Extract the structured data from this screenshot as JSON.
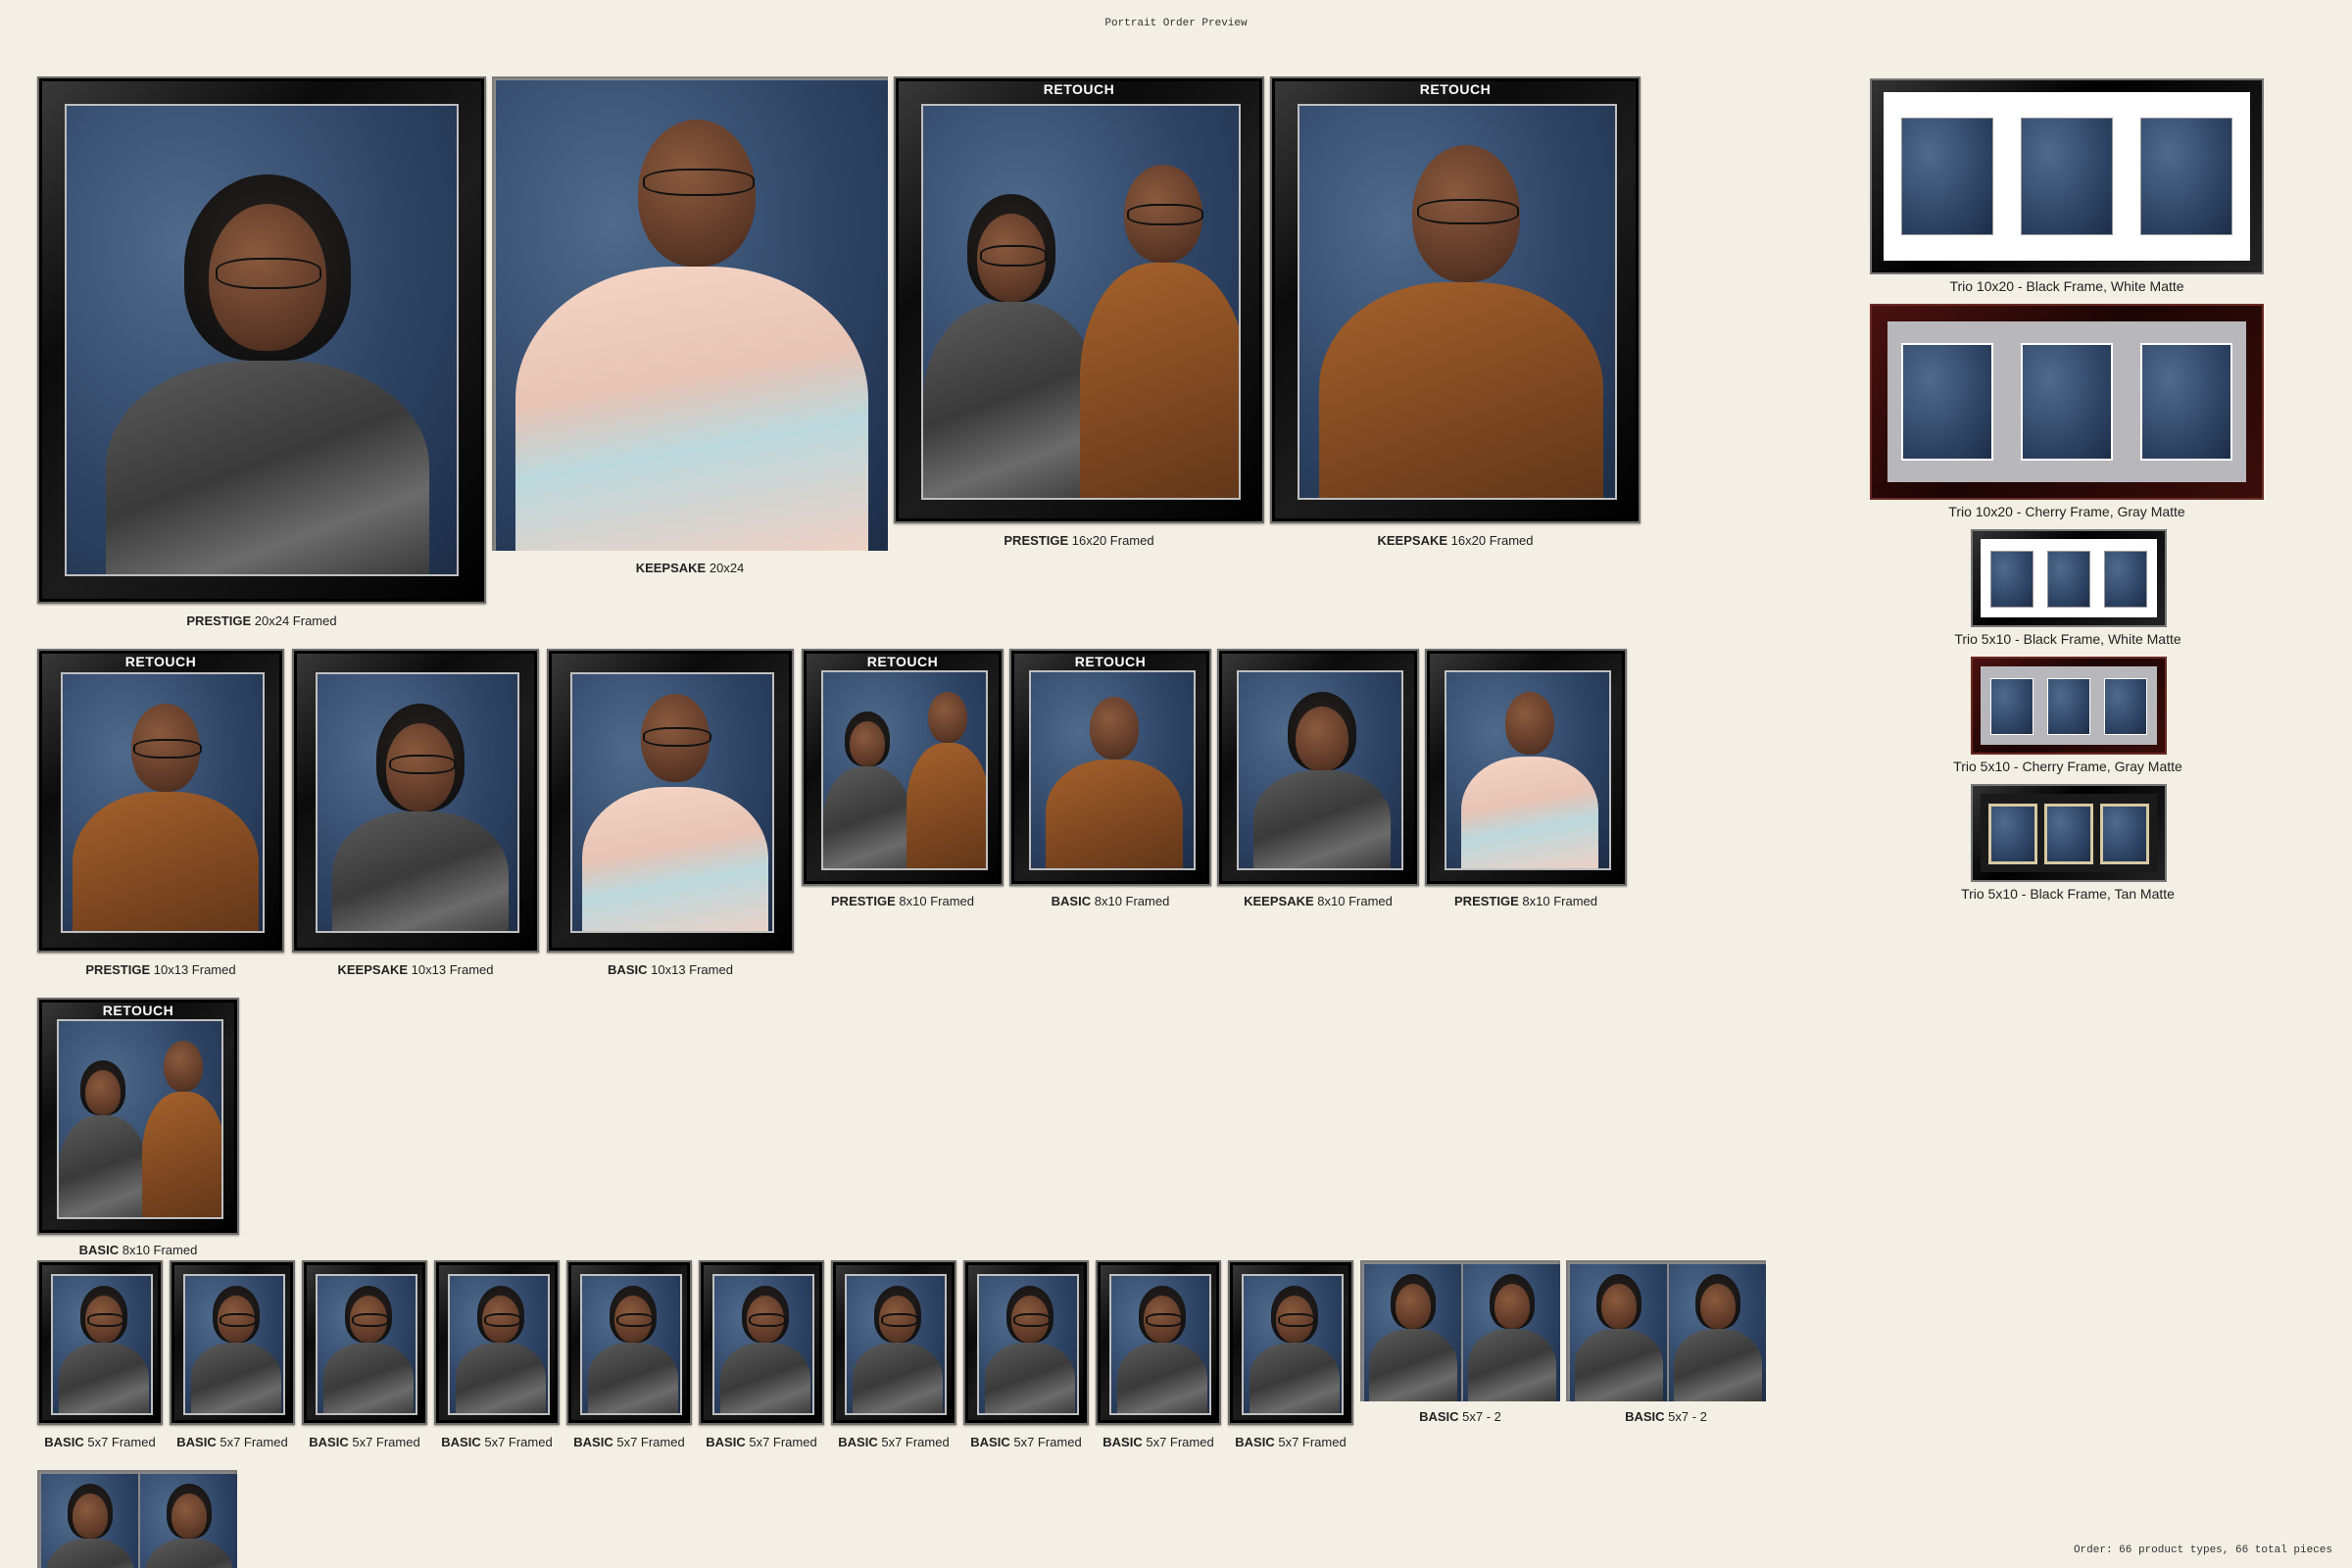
{
  "page": {
    "title": "Portrait Order Preview",
    "footer": "Order: 66 product types, 66 total pieces",
    "retouch_label": "RETOUCH"
  },
  "items": {
    "i1": {
      "tier": "PRESTIGE",
      "desc": "20x24 Framed"
    },
    "i2": {
      "tier": "KEEPSAKE",
      "desc": "20x24"
    },
    "i3": {
      "tier": "PRESTIGE",
      "desc": "16x20 Framed"
    },
    "i4": {
      "tier": "KEEPSAKE",
      "desc": "16x20 Framed"
    },
    "i5": {
      "tier": "PRESTIGE",
      "desc": "10x13 Framed"
    },
    "i6": {
      "tier": "KEEPSAKE",
      "desc": "10x13 Framed"
    },
    "i7": {
      "tier": "BASIC",
      "desc": "10x13 Framed"
    },
    "i8": {
      "tier": "PRESTIGE",
      "desc": "8x10 Framed"
    },
    "i9": {
      "tier": "BASIC",
      "desc": "8x10 Framed"
    },
    "i10": {
      "tier": "KEEPSAKE",
      "desc": "8x10 Framed"
    },
    "i11": {
      "tier": "PRESTIGE",
      "desc": "8x10 Framed"
    },
    "i12": {
      "tier": "BASIC",
      "desc": "8x10 Framed"
    },
    "s1": {
      "tier": "BASIC",
      "desc": "5x7 Framed"
    },
    "s2": {
      "tier": "BASIC",
      "desc": "5x7 Framed"
    },
    "s3": {
      "tier": "BASIC",
      "desc": "5x7 Framed"
    },
    "s4": {
      "tier": "BASIC",
      "desc": "5x7 Framed"
    },
    "s5": {
      "tier": "BASIC",
      "desc": "5x7 Framed"
    },
    "s6": {
      "tier": "BASIC",
      "desc": "5x7 Framed"
    },
    "s7": {
      "tier": "BASIC",
      "desc": "5x7 Framed"
    },
    "s8": {
      "tier": "BASIC",
      "desc": "5x7 Framed"
    },
    "s9": {
      "tier": "BASIC",
      "desc": "5x7 Framed"
    },
    "s10": {
      "tier": "BASIC",
      "desc": "5x7 Framed"
    },
    "p1": {
      "tier": "BASIC",
      "desc": "5x7 - 2"
    },
    "p2": {
      "tier": "BASIC",
      "desc": "5x7 - 2"
    }
  },
  "trios": {
    "t1": "Trio 10x20 - Black Frame, White Matte",
    "t2": "Trio 10x20 - Cherry Frame, Gray Matte",
    "t3": "Trio 5x10 - Black Frame, White Matte",
    "t4": "Trio 5x10 - Cherry Frame, Gray Matte",
    "t5": "Trio 5x10 - Black Frame, Tan Matte"
  }
}
